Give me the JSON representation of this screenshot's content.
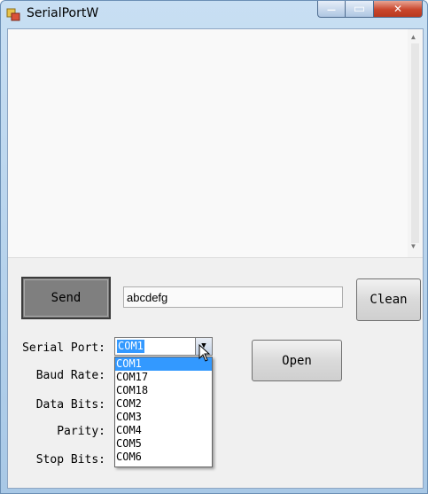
{
  "window": {
    "title": "SerialPortW",
    "min_glyph": "—",
    "max_glyph": "▭",
    "close_glyph": "✕"
  },
  "toolbar": {
    "send_label": "Send",
    "clean_label": "Clean",
    "open_label": "Open"
  },
  "send_input": {
    "value": "abcdefg"
  },
  "settings": {
    "serial_port_label": "Serial Port:",
    "baud_rate_label": "Baud Rate:",
    "data_bits_label": "Data Bits:",
    "parity_label": "Parity:",
    "stop_bits_label": "Stop Bits:",
    "serial_port_value": "COM1",
    "serial_port_options": [
      "COM1",
      "COM17",
      "COM18",
      "COM2",
      "COM3",
      "COM4",
      "COM5",
      "COM6"
    ]
  },
  "icons": {
    "app": "app-icon",
    "dropdown": "chevron-down-icon",
    "cursor": "mouse-pointer-icon"
  },
  "colors": {
    "selection": "#3399ff",
    "close": "#c9462c"
  }
}
